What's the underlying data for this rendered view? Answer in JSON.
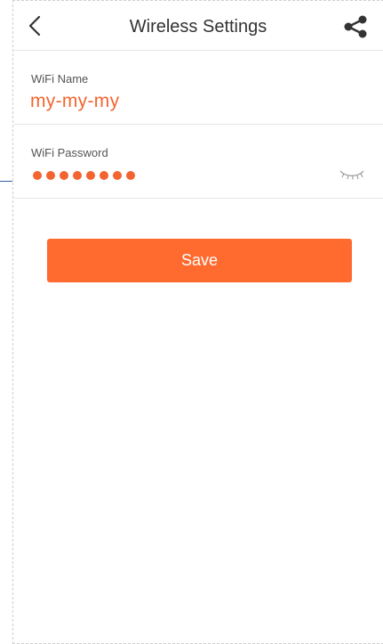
{
  "header": {
    "title": "Wireless Settings",
    "back_icon": "chevron-left-icon",
    "share_icon": "share-icon"
  },
  "wifi_name": {
    "label": "WiFi Name",
    "value": "my-my-my"
  },
  "wifi_password": {
    "label": "WiFi Password",
    "masked_dot_count": 8,
    "visibility_icon": "eye-closed-icon"
  },
  "actions": {
    "save_label": "Save"
  },
  "colors": {
    "accent": "#ff6a2f",
    "value_text": "#f26530",
    "label_text": "#555555",
    "title_text": "#333333",
    "divider": "#e7e7e7",
    "annotation_line": "#2f5f9f"
  }
}
